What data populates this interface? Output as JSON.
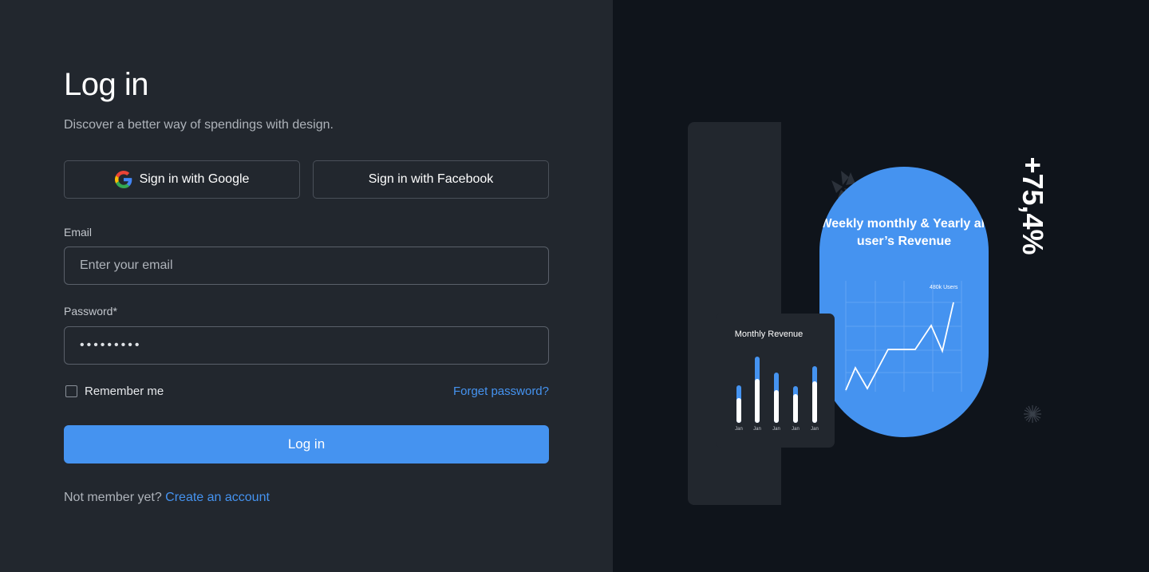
{
  "login": {
    "title": "Log in",
    "subtitle": "Discover a better way of spendings with design.",
    "google_label": "Sign in with Google",
    "facebook_label": "Sign in with Facebook",
    "email_label": "Email",
    "email_placeholder": "Enter your email",
    "password_label": "Password*",
    "password_value": "•••••••••",
    "remember_label": "Remember me",
    "forget_label": "Forget password?",
    "login_button": "Log in",
    "signup_prompt": "Not member yet?",
    "signup_link": "Create an account"
  },
  "illustration": {
    "revenue_title": "Weekly monthly & Yearly all user’s Revenue",
    "users_label": "480k Users",
    "monthly_title": "Monthly Revenue",
    "bar_labels": [
      "Jan",
      "Jan",
      "Jan",
      "Jan",
      "Jan"
    ],
    "percent": "+75,4%"
  },
  "colors": {
    "accent": "#4593f0",
    "left_bg": "#22272e",
    "right_bg": "#0f141b"
  }
}
